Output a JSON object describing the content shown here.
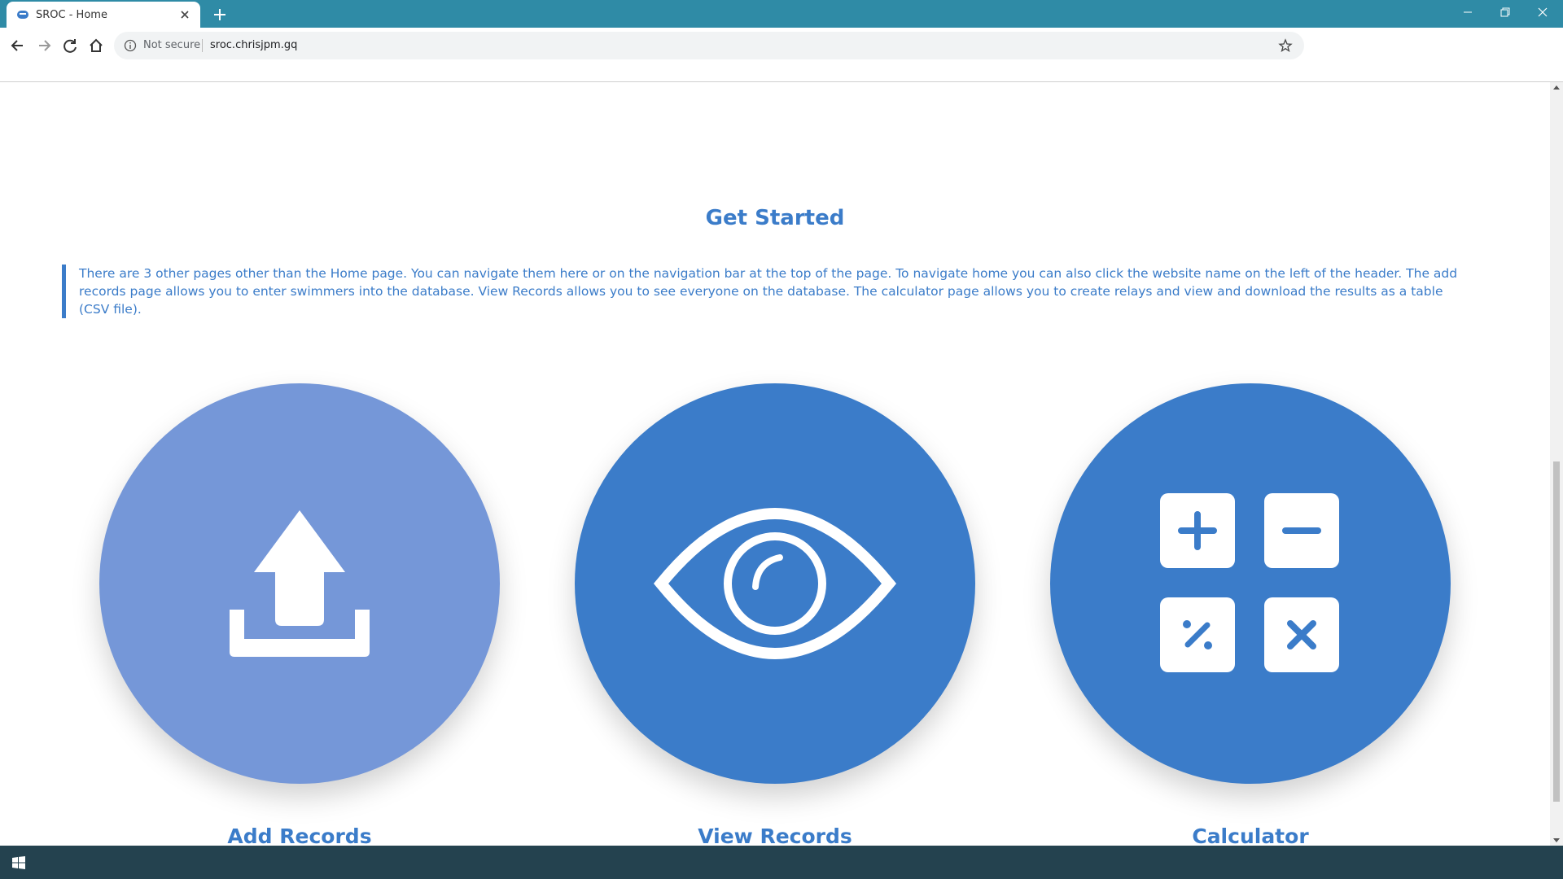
{
  "browser": {
    "tab_title": "SROC - Home",
    "security_label": "Not secure",
    "url": "sroc.chrisjpm.gq"
  },
  "page": {
    "section_title": "Get Started",
    "intro_text": "There are 3 other pages other than the Home page. You can navigate them here or on the navigation bar at the top of the page. To navigate home you can also click the website name on the left of the header. The add records page allows you to enter swimmers into the database. View Records allows you to see everyone on the database. The calculator page allows you to create relays and view and download the results as a table (CSV file).",
    "cards": [
      {
        "label": "Add Records",
        "icon": "upload-icon",
        "color": "#7597d8"
      },
      {
        "label": "View Records",
        "icon": "eye-icon",
        "color": "#3b7cc9"
      },
      {
        "label": "Calculator",
        "icon": "calculator-icon",
        "color": "#3b7cc9"
      }
    ]
  },
  "colors": {
    "tabbar": "#2f8ba6",
    "accent": "#3b7cc9",
    "accent_light": "#7597d8",
    "taskbar": "#24424f"
  }
}
